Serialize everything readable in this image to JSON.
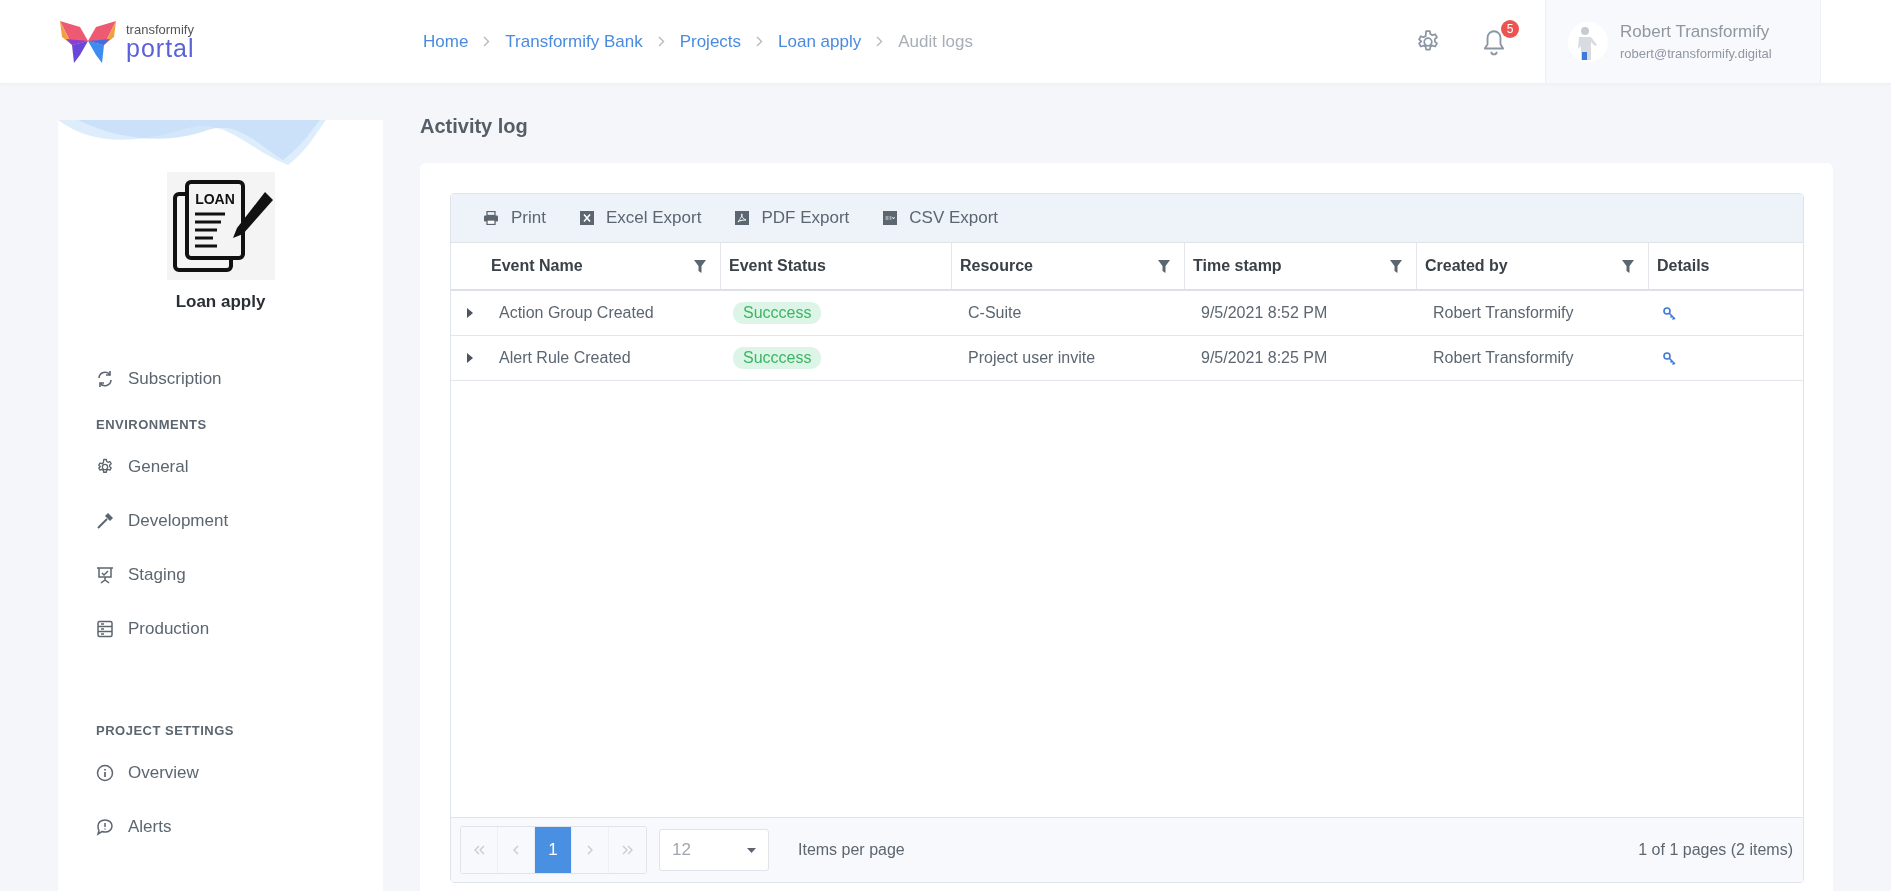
{
  "header": {
    "logo": {
      "top": "transformify",
      "bottom": "portal"
    },
    "breadcrumb": [
      {
        "label": "Home",
        "current": false
      },
      {
        "label": "Transformify Bank",
        "current": false
      },
      {
        "label": "Projects",
        "current": false
      },
      {
        "label": "Loan apply",
        "current": false
      },
      {
        "label": "Audit logs",
        "current": true
      }
    ],
    "notifications": {
      "count": "5"
    },
    "user": {
      "name": "Robert Transformify",
      "email": "robert@transformify.digital"
    }
  },
  "sidebar": {
    "project_image_text": "LOAN",
    "project_name": "Loan apply",
    "top_items": [
      {
        "label": "Subscription"
      }
    ],
    "sections": [
      {
        "heading": "ENVIRONMENTS",
        "items": [
          {
            "label": "General"
          },
          {
            "label": "Development"
          },
          {
            "label": "Staging"
          },
          {
            "label": "Production"
          }
        ]
      },
      {
        "heading": "PROJECT SETTINGS",
        "items": [
          {
            "label": "Overview"
          },
          {
            "label": "Alerts"
          }
        ]
      }
    ]
  },
  "page": {
    "title": "Activity log"
  },
  "toolbar": [
    "Print",
    "Excel Export",
    "PDF Export",
    "CSV Export"
  ],
  "table": {
    "columns": [
      {
        "label": "Event Name",
        "filterable": true
      },
      {
        "label": "Event Status",
        "filterable": false
      },
      {
        "label": "Resource",
        "filterable": true
      },
      {
        "label": "Time stamp",
        "filterable": true
      },
      {
        "label": "Created by",
        "filterable": true
      },
      {
        "label": "Details",
        "filterable": false
      }
    ],
    "rows": [
      {
        "expanded": false,
        "event_name": "Action Group Created",
        "event_status": "Succcess",
        "resource": "C-Suite",
        "time_stamp": "9/5/2021 8:52 PM",
        "created_by": "Robert Transformify"
      },
      {
        "expanded": false,
        "event_name": "Alert Rule Created",
        "event_status": "Succcess",
        "resource": "Project user invite",
        "time_stamp": "9/5/2021 8:25 PM",
        "created_by": "Robert Transformify"
      }
    ]
  },
  "pager": {
    "pages": [
      {
        "label": "1",
        "selected": true
      }
    ],
    "page_size": "12",
    "page_size_label": "Items per page",
    "summary": "1 of 1 pages (2 items)"
  }
}
